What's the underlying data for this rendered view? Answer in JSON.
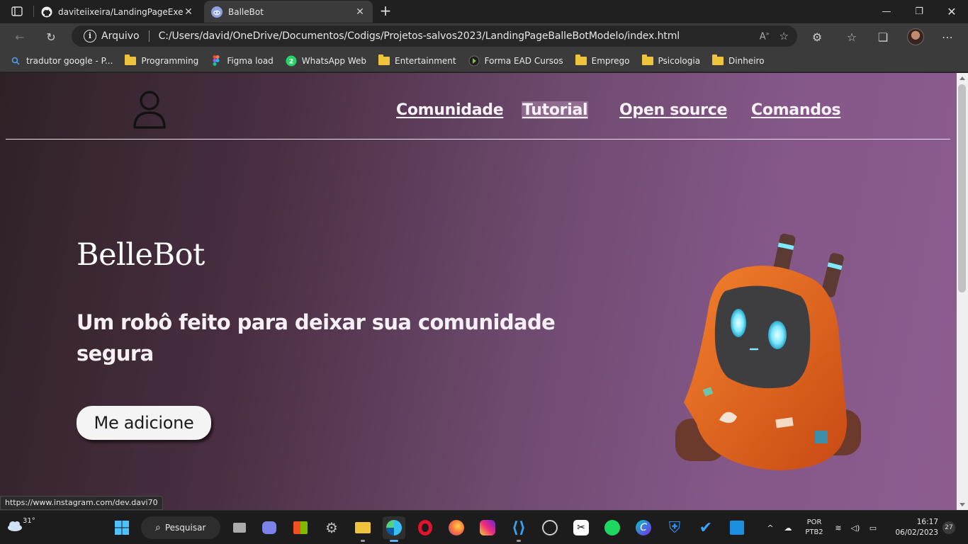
{
  "browser": {
    "tabs": [
      {
        "title": "daviteiixeira/LandingPageExercise",
        "active": false,
        "icon": "github-icon"
      },
      {
        "title": "BalleBot",
        "active": true,
        "icon": "discord-icon"
      }
    ],
    "new_tab_label": "+",
    "address": {
      "security_label": "Arquivo",
      "url": "C:/Users/david/OneDrive/Documentos/Codigs/Projetos-salvos2023/LandingPageBalleBotModelo/index.html"
    },
    "bookmarks": [
      {
        "label": "tradutor google - P...",
        "icon": "google-search-icon"
      },
      {
        "label": "Programming",
        "icon": "folder-icon"
      },
      {
        "label": "Figma load",
        "icon": "figma-icon"
      },
      {
        "label": "WhatsApp Web",
        "icon": "whatsapp-icon"
      },
      {
        "label": "Entertainment",
        "icon": "folder-icon"
      },
      {
        "label": "Forma EAD Cursos",
        "icon": "forma-ead-icon"
      },
      {
        "label": "Emprego",
        "icon": "folder-icon"
      },
      {
        "label": "Psicologia",
        "icon": "folder-icon"
      },
      {
        "label": "Dinheiro",
        "icon": "folder-icon"
      }
    ],
    "status_url": "https://www.instagram.com/dev.davi70"
  },
  "page": {
    "nav": [
      "Comunidade",
      "Tutorial",
      "Open source",
      "Comandos"
    ],
    "hero_title": "BelleBot",
    "hero_subtitle": "Um robô feito para deixar sua comunidade segura",
    "cta_label": "Me adicione"
  },
  "taskbar": {
    "weather_temp": "31°",
    "search_label": "Pesquisar",
    "language_line1": "POR",
    "language_line2": "PTB2",
    "time": "16:17",
    "date": "06/02/2023",
    "notification_count": "27"
  },
  "colors": {
    "page_gradient_start": "#2e2126",
    "page_gradient_end": "#8c5c8f",
    "robot_orange": "#e8641e",
    "robot_eye": "#7fe9ff"
  }
}
